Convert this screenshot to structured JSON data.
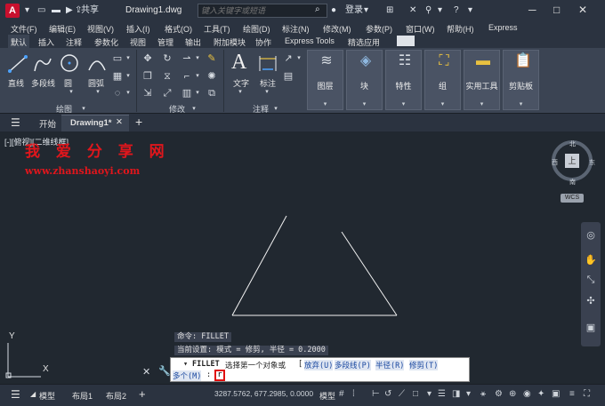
{
  "titlebar": {
    "logo_letter": "A",
    "share_label": "共享",
    "document_title": "Drawing1.dwg",
    "search_placeholder": "键入关键字或短语",
    "login_label": "登录"
  },
  "menu": {
    "items": [
      "文件(F)",
      "编辑(E)",
      "视图(V)",
      "插入(I)",
      "格式(O)",
      "工具(T)",
      "绘图(D)",
      "标注(N)",
      "修改(M)",
      "参数(P)",
      "窗口(W)",
      "帮助(H)",
      "Express"
    ]
  },
  "ribbon_tabs": {
    "items": [
      "默认",
      "插入",
      "注释",
      "参数化",
      "视图",
      "管理",
      "输出",
      "附加模块",
      "协作",
      "Express Tools",
      "精选应用"
    ]
  },
  "ribbon": {
    "draw_tools": [
      "直线",
      "多段线",
      "圆",
      "圆弧"
    ],
    "text_tool": "文字",
    "dim_tool": "标注",
    "panels": [
      "绘图",
      "修改",
      "注释"
    ],
    "big_panels": [
      "图层",
      "块",
      "特性",
      "组",
      "实用工具",
      "剪贴板"
    ]
  },
  "doc_tabs": {
    "start": "开始",
    "active": "Drawing1*"
  },
  "canvas": {
    "view_label": "[-][俯视][二维线框]",
    "watermark_title": "我 爱 分 享 网",
    "watermark_url": "www.zhanshaoyi.com",
    "viewcube": {
      "north": "北",
      "south": "南",
      "east": "东",
      "west": "西",
      "top": "上",
      "wcs": "WCS"
    },
    "ucs_y": "Y",
    "ucs_x": "X"
  },
  "command": {
    "history_1": "命令: FILLET",
    "history_2": "当前设置: 模式 = 修剪, 半径 = 0.2000",
    "prompt_cmd": "FILLET",
    "prompt_text": "选择第一个对象或",
    "option_1": "放弃(U)",
    "option_2": "多段线(P)",
    "option_3": "半径(R)",
    "option_4": "修剪(T)",
    "option_5": "多个(M)",
    "input_value": "r"
  },
  "statusbar": {
    "model_tab": "模型",
    "layout1": "布局1",
    "layout2": "布局2",
    "coords": "3287.5762, 677.2985, 0.0000",
    "model_label": "模型"
  }
}
